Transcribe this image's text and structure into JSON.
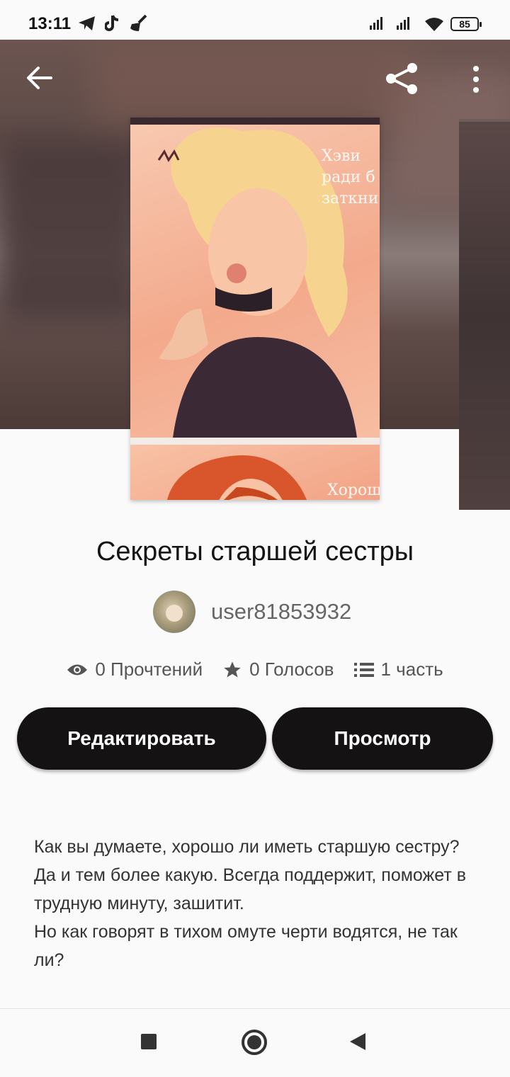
{
  "status_bar": {
    "time": "13:11",
    "battery": "85"
  },
  "book": {
    "title": "Секреты старшей сестры",
    "author": "user81853932",
    "cover_text_top": "Хэви ради б заткни",
    "cover_text_bottom": "Хорош прост"
  },
  "stats": {
    "reads": "0 Прочтений",
    "votes": "0 Голосов",
    "parts": "1 часть"
  },
  "buttons": {
    "edit": "Редактировать",
    "view": "Просмотр"
  },
  "description": [
    "Как вы думаете, хорошо ли иметь старшую сестру?",
    "Да и тем более какую. Всегда поддержит, поможет в трудную минуту, зашитит.",
    "Но как говорят в тихом омуте черти водятся, не так ли?"
  ],
  "icons": [
    "back-arrow-icon",
    "share-icon",
    "more-vert-icon",
    "eye-icon",
    "star-icon",
    "list-icon",
    "square-nav-icon",
    "home-circle-icon",
    "back-triangle-icon"
  ]
}
